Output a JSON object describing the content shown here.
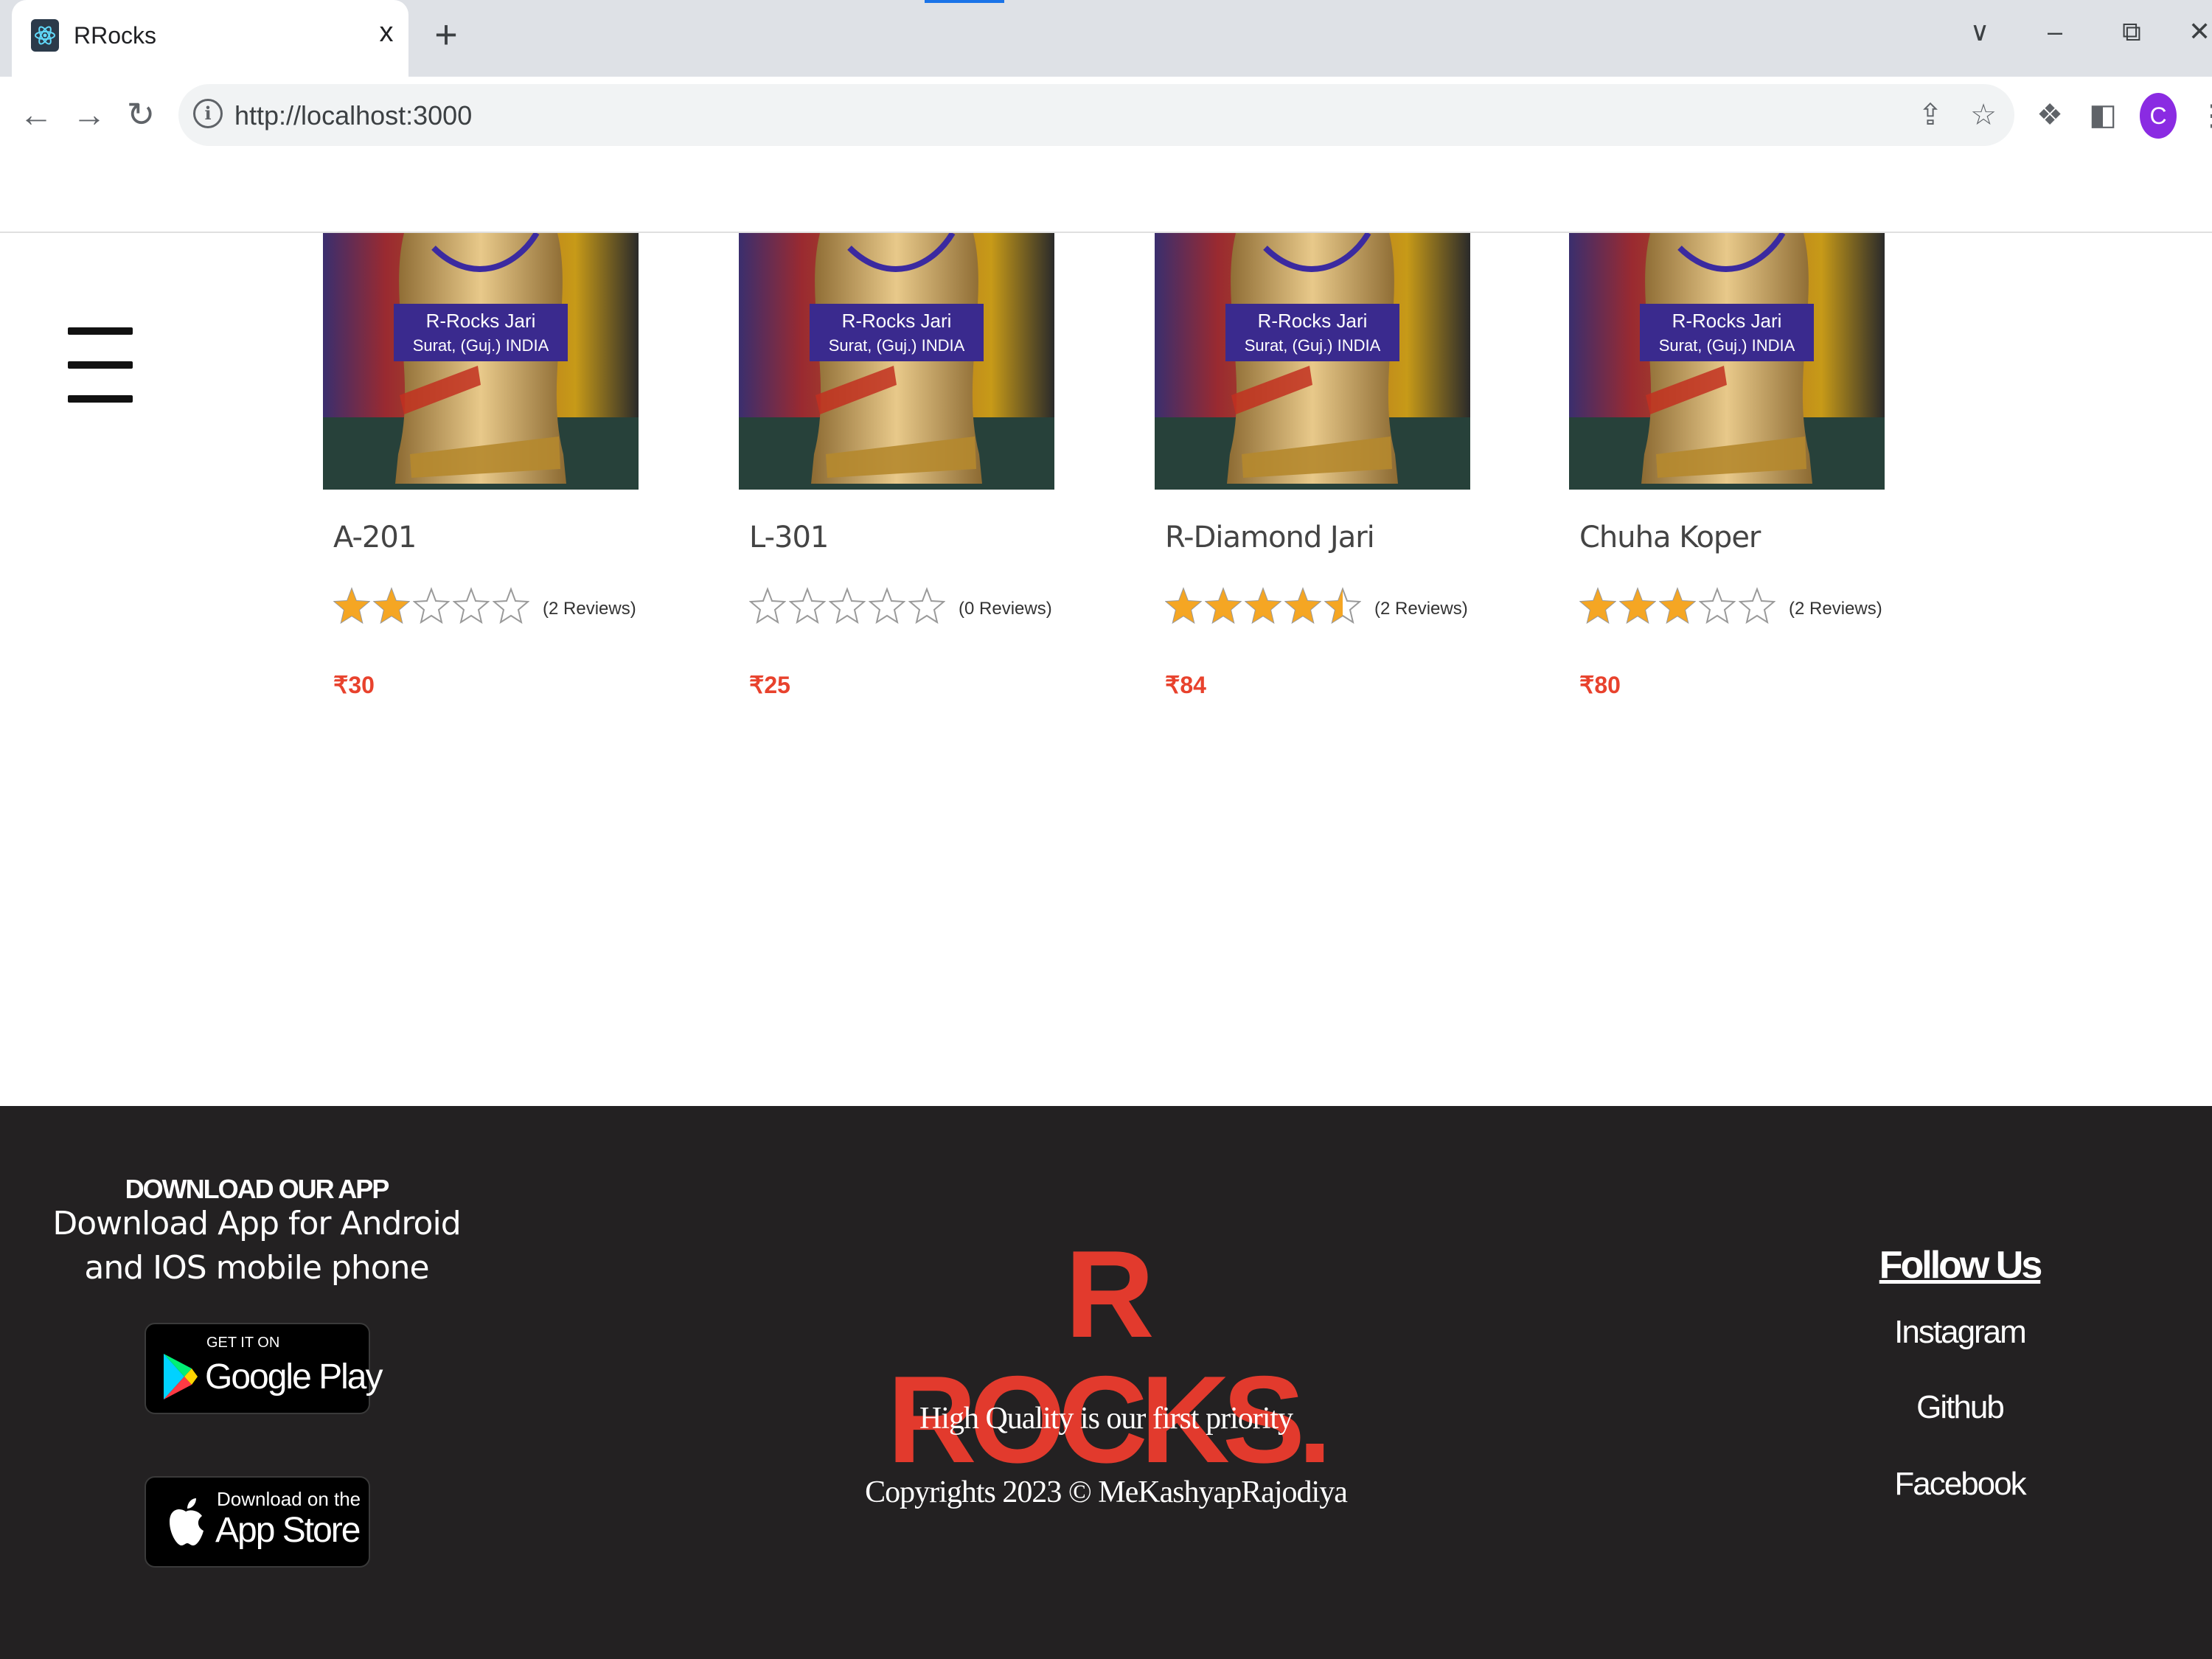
{
  "browser": {
    "tab_title": "RRocks",
    "tab_close": "x",
    "new_tab": "+",
    "url": "http://localhost:3000",
    "avatar_initial": "C"
  },
  "products": [
    {
      "name": "A-201",
      "rating": 2,
      "reviews": "(2 Reviews)",
      "price": "₹30"
    },
    {
      "name": "L-301",
      "rating": 0,
      "reviews": "(0 Reviews)",
      "price": "₹25"
    },
    {
      "name": "R-Diamond Jari",
      "rating": 4.5,
      "reviews": "(2 Reviews)",
      "price": "₹84"
    },
    {
      "name": "Chuha Koper",
      "rating": 3,
      "reviews": "(2 Reviews)",
      "price": "₹80"
    }
  ],
  "product_image_label": {
    "line1": "R-Rocks Jari",
    "line2": "Surat, (Guj.) INDIA"
  },
  "footer": {
    "download": {
      "heading": "DOWNLOAD OUR APP",
      "text": "Download App for Android and IOS mobile phone",
      "google_play_small": "GET IT ON",
      "google_play_big": "Google Play",
      "app_store_small": "Download on the",
      "app_store_big": "App Store"
    },
    "brand": "R ROCKS.",
    "tagline": "High Quality is our first priority",
    "copyright": "Copyrights 2023 © MeKashyapRajodiya",
    "follow": {
      "title": "Follow Us",
      "links": [
        "Instagram",
        "Github",
        "Facebook"
      ]
    }
  },
  "colors": {
    "accent": "#e23a2d",
    "price": "#e8422d",
    "star": "#f5a623",
    "footer_bg": "#232122"
  }
}
